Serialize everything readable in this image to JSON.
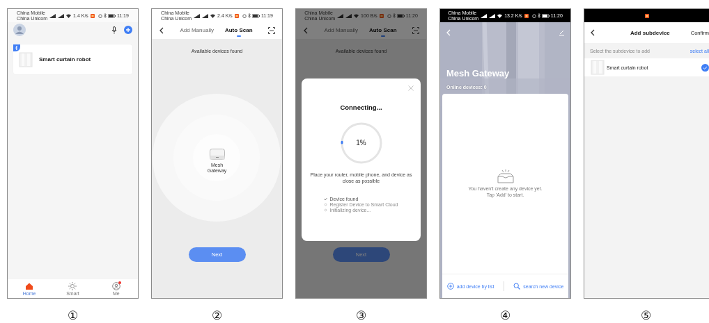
{
  "panels": [
    {
      "kind": "home",
      "number": "①",
      "status": {
        "carrier_1": "China Mobile",
        "carrier_2": "China Unicom",
        "speed": "1.4 K/s",
        "time": "11:19",
        "dark": false
      },
      "devices": [
        {
          "name": "Smart curtain robot",
          "bluetooth": true
        }
      ],
      "tabs": [
        {
          "label": "Home",
          "selected": true,
          "badge": false
        },
        {
          "label": "Smart",
          "selected": false,
          "badge": false
        },
        {
          "label": "Me",
          "selected": false,
          "badge": true
        }
      ]
    },
    {
      "kind": "scan",
      "number": "②",
      "status": {
        "carrier_1": "China Mobile",
        "carrier_2": "China Unicom",
        "speed": "2.4 K/s",
        "time": "11:19",
        "dark": false
      },
      "tabs": [
        {
          "label": "Add Manually",
          "selected": false
        },
        {
          "label": "Auto Scan",
          "selected": true
        }
      ],
      "heading": "Available devices found",
      "found_device": "Mesh Gateway",
      "next_button": "Next"
    },
    {
      "kind": "scan",
      "number": "③",
      "status": {
        "carrier_1": "China Mobile",
        "carrier_2": "China Unicom",
        "speed": "100 B/s",
        "time": "11:20",
        "dark": false
      },
      "tabs": [
        {
          "label": "Add Manually",
          "selected": false
        },
        {
          "label": "Auto Scan",
          "selected": true
        }
      ],
      "heading": "Available devices found",
      "next_button": "Next",
      "dialog": {
        "title": "Connecting...",
        "level": 0.01,
        "percent": "1%",
        "hint": "Place your router, mobile phone, and device as close as possible",
        "steps": [
          {
            "label": "Device found",
            "done": true
          },
          {
            "label": "Register Device to Smart Cloud",
            "done": false
          },
          {
            "label": "Initializing device...",
            "done": false
          }
        ]
      }
    },
    {
      "kind": "gateway",
      "number": "④",
      "status": {
        "carrier_1": "China Mobile",
        "carrier_2": "China Unicom",
        "speed": "13.2 K/s",
        "time": "11:20",
        "dark": true
      },
      "title": "Mesh Gateway",
      "subtitle": "Online devices: 0",
      "empty_message": "You haven't create any device yet.\nTap 'Add' to start.",
      "actions": [
        {
          "kind": "list",
          "label": "add device by list"
        },
        {
          "kind": "search",
          "label": "search new device"
        }
      ]
    },
    {
      "kind": "subdevices",
      "number": "⑤",
      "status": {
        "dark": true
      },
      "title": "Add subdevice",
      "confirm": "Confirm",
      "section_label": "Select the subdevice to add",
      "select_all": "select all",
      "devices": [
        {
          "name": "Smart curtain robot",
          "checked": true
        }
      ]
    }
  ]
}
